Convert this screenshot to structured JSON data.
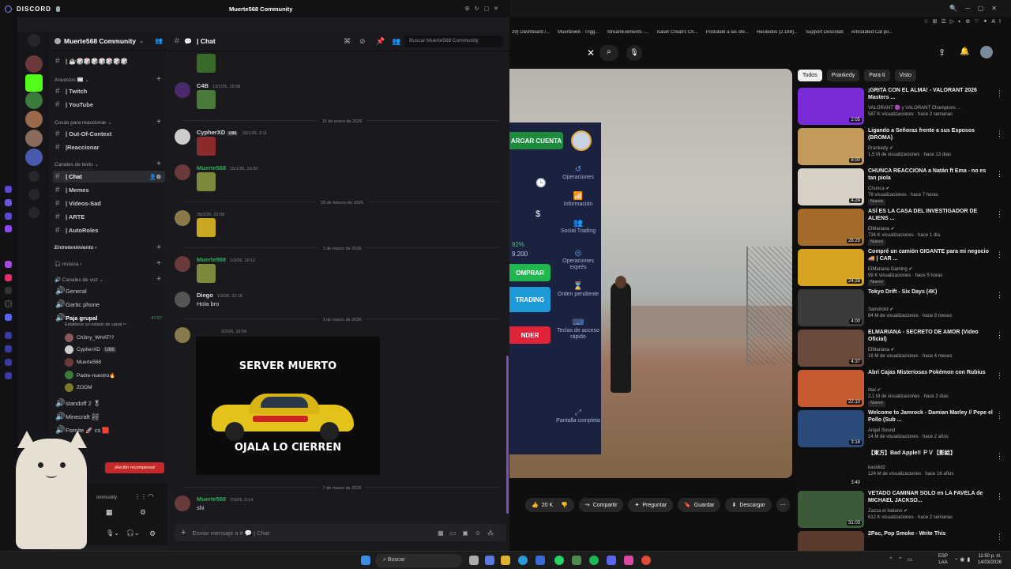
{
  "discord": {
    "app_name": "DISCORD",
    "window_title": "Muerte568 Community",
    "server_name": "Muerte568 Community",
    "top_channel": "| ☕🎲🎲🎲🎲🎲🎲🎲",
    "categories": [
      {
        "label": "Anuncios 📰",
        "channels": [
          "| Twitch",
          "| YouTube"
        ]
      },
      {
        "label": "Cosas para reaccionar",
        "channels": [
          "| Out-Of-Context",
          "|Reaccionar"
        ]
      },
      {
        "label": "Canales de texto",
        "channels": [
          "| Chat",
          "| Memes",
          "| Videos-Sad",
          "| ARTE",
          "| AutoRoles"
        ]
      },
      {
        "label": "Entretenimiento",
        "channels": []
      },
      {
        "label": "música",
        "channels": []
      },
      {
        "label": "Canales de voz",
        "channels": [
          "General",
          "Gartic phone",
          "Paja grupal"
        ]
      }
    ],
    "voice_status": "Establece un estado de canal ✏",
    "voice_timer": "47:57",
    "voice_users": [
      "Ch3rry_WHAT!?",
      "CypherXD",
      "Muerte568",
      "Padre-nuestro🔥",
      "ZOOM"
    ],
    "voice_user_tag": "U86",
    "more_voice": [
      "standoff 2 🎖",
      "Minecraft 🏞",
      "Fornite 🚀 cs 🟥"
    ],
    "reward_button": "¡Recibir recompensa!",
    "chat_header": "| Chat",
    "search_placeholder": "Buscar Muerte568 Community",
    "messages": [
      {
        "name": "C4B",
        "time": "13/1/26, 15:08",
        "color": "#d6d6d6",
        "text": ""
      },
      {
        "name": "CypherXD",
        "tag": "U86",
        "time": "15/1/26, 0:11",
        "color": "#dbdee1",
        "text": ""
      },
      {
        "name": "Muerte568",
        "time": "15/1/26, 19:30",
        "color": "#3ba55d",
        "text": ""
      },
      {
        "name": "",
        "time": "28/2/26, 22:08",
        "color": "#dbdee1",
        "text": ""
      },
      {
        "name": "Muerte568",
        "time": "1/3/26, 19:12",
        "color": "#3ba55d",
        "text": ""
      },
      {
        "name": "Diego",
        "time": "1/3/26, 22:15",
        "color": "#dbdee1",
        "text": "Hola bro"
      },
      {
        "name": "",
        "time": "3/3/26, 19:54",
        "color": "#dbdee1",
        "text": ""
      },
      {
        "name": "Muerte568",
        "time": "7/3/26, 0:14",
        "color": "#3ba55d",
        "text": "shi"
      }
    ],
    "date_separators": [
      "15 de enero de 2026",
      "28 de febrero de 2026",
      "1 de marzo de 2026",
      "3 de marzo de 2026",
      "7 de marzo de 2026"
    ],
    "meme_top": "SERVER MUERTO",
    "meme_bottom": "OJALA LO CIERREN",
    "composer_placeholder": "Enviar mensaje a # 💬 | Chat",
    "user_bar_label": "ommunity"
  },
  "youtube": {
    "bookmarks": [
      "29) Dashboard /...",
      "Muerte568 - Trigg...",
      "StreamElements -...",
      "Isaiah Creati's Ch...",
      "Postúlate a las ofe...",
      "Recibidos (2.189)...",
      "Support Descolab",
      "Articulated Cat po..."
    ],
    "chips": [
      "Todos",
      "Prankedy",
      "Para ti",
      "Visto"
    ],
    "video_panel": {
      "buttons": [
        "ARGAR CUENTA",
        "OMPRAR",
        "TRADING",
        "NDER"
      ],
      "menu": [
        "Operaciones",
        "Información",
        "Social Trading",
        "Operaciones exprés",
        "Orden pendiente",
        "Teclas de acceso rápido",
        "Pantalla completa"
      ],
      "figure_top": "92%",
      "figure_bottom": "9.200"
    },
    "actions": [
      "20 K",
      "Compartir",
      "Preguntar",
      "Guardar",
      "Descargar"
    ],
    "recommended": [
      {
        "title": "¡GRITA CON EL ALMA! - VALORANT 2026 Masters ...",
        "channel": "VALORANT 🟣 y VALORANT Champions ...",
        "meta": "587 K visualizaciones · hace 2 semanas",
        "dur": "2:05",
        "color": "#7a2ad6",
        "new": ""
      },
      {
        "title": "Ligando a Señoras frente a sus Esposos (BROMA)",
        "channel": "Prankedy ✔",
        "meta": "1,5 M de visualizaciones · hace 13 días",
        "dur": "8:00",
        "color": "#c49a5a",
        "new": ""
      },
      {
        "title": "CHUNCA REACCIONA a Natán ft Ema - no es tan piola",
        "channel": "Chunca ✔",
        "meta": "78 visualizaciones · hace 7 horas",
        "dur": "4:24",
        "color": "#d8d0c4",
        "new": "Nuevo"
      },
      {
        "title": "ASÍ ES LA CASA DEL INVESTIGADOR DE ALIENS ...",
        "channel": "ElMariana ✔",
        "meta": "734 K visualizaciones · hace 1 día",
        "dur": "28:29",
        "color": "#a46a2a",
        "new": "Nuevo"
      },
      {
        "title": "Compré un camión GIGANTE para mi negocio 🚚 | CAR ...",
        "channel": "ElMariana Gaming ✔",
        "meta": "99 K visualizaciones · hace 5 horas",
        "dur": "24:28",
        "color": "#d8a320",
        "new": "Nuevo"
      },
      {
        "title": "Tokyo Drift - Six Days (4K)",
        "channel": "Samdroid ✔",
        "meta": "84 M de visualizaciones · hace 9 meses",
        "dur": "4:00",
        "color": "#3a3a3a",
        "new": ""
      },
      {
        "title": "ELMARIANA - SECRETO DE AMOR (Video Oficial)",
        "channel": "ElMariana ✔",
        "meta": "16 M de visualizaciones · hace 4 meses",
        "dur": "4:37",
        "color": "#6a4a3a",
        "new": ""
      },
      {
        "title": "Abrí Cajas Misteriosas Pokémon con Rubius",
        "channel": "Ibai ✔",
        "meta": "2,1 M de visualizaciones · hace 2 días",
        "dur": "22:10",
        "color": "#c85a30",
        "new": "Nuevo"
      },
      {
        "title": "Welcome to Jamrock - Damian Marley // Pepe el Pollo (Sub ...",
        "channel": "Angel Sound",
        "meta": "14 M de visualizaciones · hace 2 años",
        "dur": "3:18",
        "color": "#2a4a7a",
        "new": ""
      },
      {
        "title": "【東方】Bad Apple!! ＰＶ【影絵】",
        "channel": "kasidid2",
        "meta": "124 M de visualizaciones · hace 16 años",
        "dur": "3:40",
        "color": "#101010",
        "new": ""
      },
      {
        "title": "VETADO CAMINAR SOLO en LA FAVELA de MICHAEL JACKSO...",
        "channel": "Zazza el italiano ✔",
        "meta": "612 K visualizaciones · hace 2 semanas",
        "dur": "31:03",
        "color": "#3a5a3a",
        "new": ""
      },
      {
        "title": "2Pac, Pop Smoke - Write This",
        "channel": "",
        "meta": "",
        "dur": "",
        "color": "#5a3a2a",
        "new": ""
      }
    ]
  },
  "taskbar": {
    "search": "Buscar",
    "lang_top": "ESP",
    "lang_bottom": "LAA",
    "time": "11:50 p. m.",
    "date": "14/03/2026"
  }
}
